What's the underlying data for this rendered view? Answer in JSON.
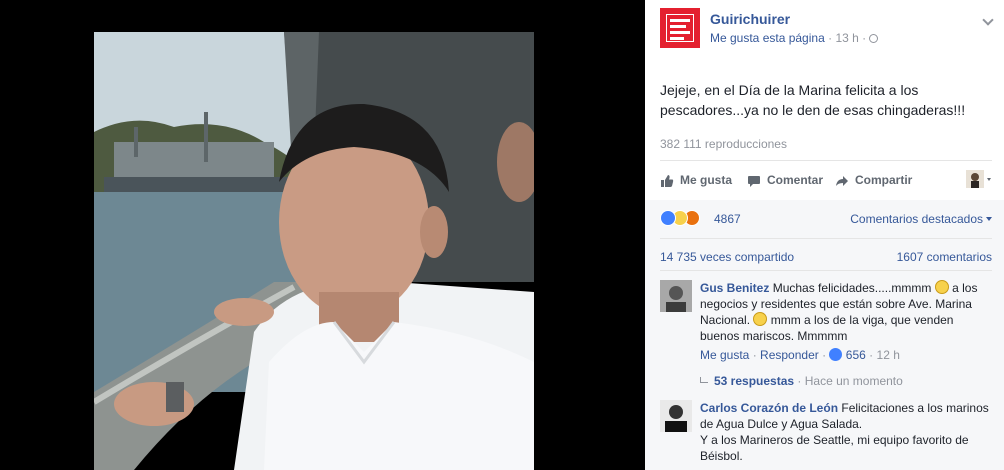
{
  "page": {
    "name": "Guirichuirer",
    "logo_text": "GUIRICHUIRER",
    "like_page": "Me gusta esta página",
    "time": "13 h",
    "separator": "·"
  },
  "post": {
    "text": "Jejeje, en el Día de la Marina felicita a los pescadores...ya no le den de esas chingaderas!!!",
    "views": "382 111 reproducciones"
  },
  "actions": {
    "like": "Me gusta",
    "comment": "Comentar",
    "share": "Compartir"
  },
  "stats": {
    "reaction_count": "4867",
    "sort_label": "Comentarios destacados",
    "shares": "14 735 veces compartido",
    "comments": "1607 comentarios"
  },
  "comments": [
    {
      "author": "Gus Benitez",
      "text_a": "Muchas felicidades.....mmmm",
      "text_b": "a los negocios y residentes que están sobre Ave. Marina Nacional.",
      "text_c": "mmm a los de la viga, que venden buenos mariscos. Mmmmm",
      "like": "Me gusta",
      "reply": "Responder",
      "likes": "656",
      "time": "12 h",
      "replies": "53 respuestas",
      "replies_time": "Hace un momento"
    },
    {
      "author": "Carlos Corazón de León",
      "text": "Felicitaciones a los marinos de Agua Dulce y Agua Salada.",
      "text2": "Y a los Marineros de Seattle, mi equipo favorito de Béisbol."
    }
  ],
  "colors": {
    "brand": "#e4202f",
    "link": "#365899",
    "muted": "#90949c",
    "ufi_bg": "#f6f7f9"
  }
}
